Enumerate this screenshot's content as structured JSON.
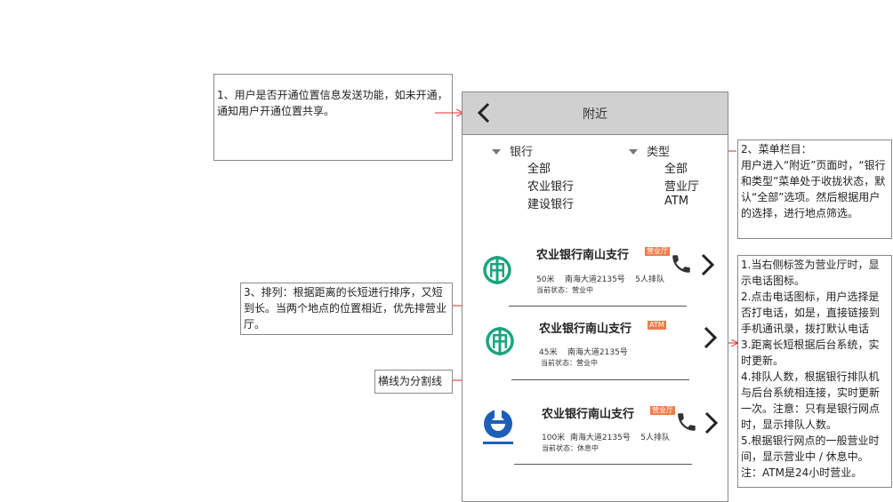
{
  "notes": {
    "n1": "1、用户是否开通位置信息发送功能，如未开通，通知用户开通位置共享。",
    "n2": "2、菜单栏目：\n用户进入“附近”页面时，“银行和类型”菜单处于收拢状态，默认“全部”选项。然后根据用户的选择，进行地点筛选。",
    "n3": "1.当右侧标签为营业厅时，显示电话图标。\n2.点击电话图标，用户选择是否打电话，如是，直接链接到手机通讯录，拨打默认电话\n3.距离长短根据后台系统，实时更新。\n4.排队人数，根据银行排队机与后台系统相连接，实时更新一次。注意：只有是银行网点时，显示排队人数。\n5.根据银行网点的一般营业时间，显示营业中 / 休息中。\n注：ATM是24小时营业。",
    "n4": "3、排列：根据距离的长短进行排序，又短到长。当两个地点的位置相近，优先排营业厅。",
    "n5": "横线为分割线"
  },
  "phone": {
    "title": "附近",
    "menu": {
      "bank": {
        "label": "银行",
        "options": [
          "全部",
          "农业银行",
          "建设银行"
        ]
      },
      "type": {
        "label": "类型",
        "options": [
          "全部",
          "营业厅",
          "ATM"
        ]
      }
    },
    "cards": [
      {
        "name": "农业银行南山支行",
        "tag": "营业厅",
        "distance": "50米",
        "address": "南海大道2135号",
        "queue": "5人排队",
        "status": "当前状态：营业中",
        "logo": "abc-bank-logo",
        "phone": true
      },
      {
        "name": "农业银行南山支行",
        "tag": "ATM",
        "distance": "45米",
        "address": "南海大道2135号",
        "queue": "",
        "status": "当前状态：营业中",
        "logo": "abc-bank-logo",
        "phone": false
      },
      {
        "name": "农业银行南山支行",
        "tag": "营业厅",
        "distance": "100米",
        "address": "南海大道2135号",
        "queue": "5人排队",
        "status": "当前状态：休息中",
        "logo": "ccb-bank-logo",
        "phone": true
      }
    ]
  },
  "colors": {
    "tag": "#f07c4a",
    "abc_green": "#1aa57f",
    "ccb_blue": "#1d5fb8",
    "arrow_red": "#e8262b",
    "topbar": "#d0d0d0"
  }
}
